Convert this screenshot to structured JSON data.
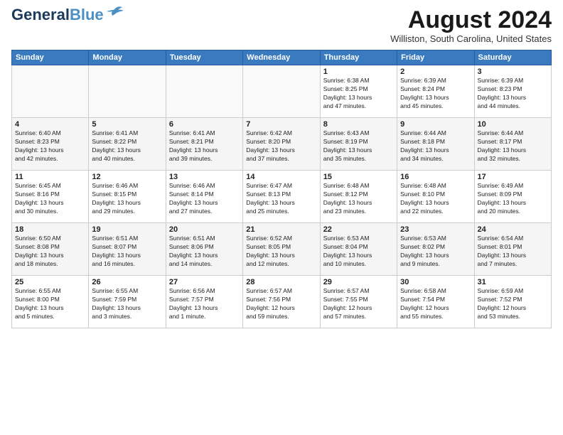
{
  "header": {
    "logo_line1": "General",
    "logo_line2": "Blue",
    "month": "August 2024",
    "location": "Williston, South Carolina, United States"
  },
  "weekdays": [
    "Sunday",
    "Monday",
    "Tuesday",
    "Wednesday",
    "Thursday",
    "Friday",
    "Saturday"
  ],
  "weeks": [
    [
      {
        "day": "",
        "info": ""
      },
      {
        "day": "",
        "info": ""
      },
      {
        "day": "",
        "info": ""
      },
      {
        "day": "",
        "info": ""
      },
      {
        "day": "1",
        "info": "Sunrise: 6:38 AM\nSunset: 8:25 PM\nDaylight: 13 hours\nand 47 minutes."
      },
      {
        "day": "2",
        "info": "Sunrise: 6:39 AM\nSunset: 8:24 PM\nDaylight: 13 hours\nand 45 minutes."
      },
      {
        "day": "3",
        "info": "Sunrise: 6:39 AM\nSunset: 8:23 PM\nDaylight: 13 hours\nand 44 minutes."
      }
    ],
    [
      {
        "day": "4",
        "info": "Sunrise: 6:40 AM\nSunset: 8:23 PM\nDaylight: 13 hours\nand 42 minutes."
      },
      {
        "day": "5",
        "info": "Sunrise: 6:41 AM\nSunset: 8:22 PM\nDaylight: 13 hours\nand 40 minutes."
      },
      {
        "day": "6",
        "info": "Sunrise: 6:41 AM\nSunset: 8:21 PM\nDaylight: 13 hours\nand 39 minutes."
      },
      {
        "day": "7",
        "info": "Sunrise: 6:42 AM\nSunset: 8:20 PM\nDaylight: 13 hours\nand 37 minutes."
      },
      {
        "day": "8",
        "info": "Sunrise: 6:43 AM\nSunset: 8:19 PM\nDaylight: 13 hours\nand 35 minutes."
      },
      {
        "day": "9",
        "info": "Sunrise: 6:44 AM\nSunset: 8:18 PM\nDaylight: 13 hours\nand 34 minutes."
      },
      {
        "day": "10",
        "info": "Sunrise: 6:44 AM\nSunset: 8:17 PM\nDaylight: 13 hours\nand 32 minutes."
      }
    ],
    [
      {
        "day": "11",
        "info": "Sunrise: 6:45 AM\nSunset: 8:16 PM\nDaylight: 13 hours\nand 30 minutes."
      },
      {
        "day": "12",
        "info": "Sunrise: 6:46 AM\nSunset: 8:15 PM\nDaylight: 13 hours\nand 29 minutes."
      },
      {
        "day": "13",
        "info": "Sunrise: 6:46 AM\nSunset: 8:14 PM\nDaylight: 13 hours\nand 27 minutes."
      },
      {
        "day": "14",
        "info": "Sunrise: 6:47 AM\nSunset: 8:13 PM\nDaylight: 13 hours\nand 25 minutes."
      },
      {
        "day": "15",
        "info": "Sunrise: 6:48 AM\nSunset: 8:12 PM\nDaylight: 13 hours\nand 23 minutes."
      },
      {
        "day": "16",
        "info": "Sunrise: 6:48 AM\nSunset: 8:10 PM\nDaylight: 13 hours\nand 22 minutes."
      },
      {
        "day": "17",
        "info": "Sunrise: 6:49 AM\nSunset: 8:09 PM\nDaylight: 13 hours\nand 20 minutes."
      }
    ],
    [
      {
        "day": "18",
        "info": "Sunrise: 6:50 AM\nSunset: 8:08 PM\nDaylight: 13 hours\nand 18 minutes."
      },
      {
        "day": "19",
        "info": "Sunrise: 6:51 AM\nSunset: 8:07 PM\nDaylight: 13 hours\nand 16 minutes."
      },
      {
        "day": "20",
        "info": "Sunrise: 6:51 AM\nSunset: 8:06 PM\nDaylight: 13 hours\nand 14 minutes."
      },
      {
        "day": "21",
        "info": "Sunrise: 6:52 AM\nSunset: 8:05 PM\nDaylight: 13 hours\nand 12 minutes."
      },
      {
        "day": "22",
        "info": "Sunrise: 6:53 AM\nSunset: 8:04 PM\nDaylight: 13 hours\nand 10 minutes."
      },
      {
        "day": "23",
        "info": "Sunrise: 6:53 AM\nSunset: 8:02 PM\nDaylight: 13 hours\nand 9 minutes."
      },
      {
        "day": "24",
        "info": "Sunrise: 6:54 AM\nSunset: 8:01 PM\nDaylight: 13 hours\nand 7 minutes."
      }
    ],
    [
      {
        "day": "25",
        "info": "Sunrise: 6:55 AM\nSunset: 8:00 PM\nDaylight: 13 hours\nand 5 minutes."
      },
      {
        "day": "26",
        "info": "Sunrise: 6:55 AM\nSunset: 7:59 PM\nDaylight: 13 hours\nand 3 minutes."
      },
      {
        "day": "27",
        "info": "Sunrise: 6:56 AM\nSunset: 7:57 PM\nDaylight: 13 hours\nand 1 minute."
      },
      {
        "day": "28",
        "info": "Sunrise: 6:57 AM\nSunset: 7:56 PM\nDaylight: 12 hours\nand 59 minutes."
      },
      {
        "day": "29",
        "info": "Sunrise: 6:57 AM\nSunset: 7:55 PM\nDaylight: 12 hours\nand 57 minutes."
      },
      {
        "day": "30",
        "info": "Sunrise: 6:58 AM\nSunset: 7:54 PM\nDaylight: 12 hours\nand 55 minutes."
      },
      {
        "day": "31",
        "info": "Sunrise: 6:59 AM\nSunset: 7:52 PM\nDaylight: 12 hours\nand 53 minutes."
      }
    ]
  ]
}
